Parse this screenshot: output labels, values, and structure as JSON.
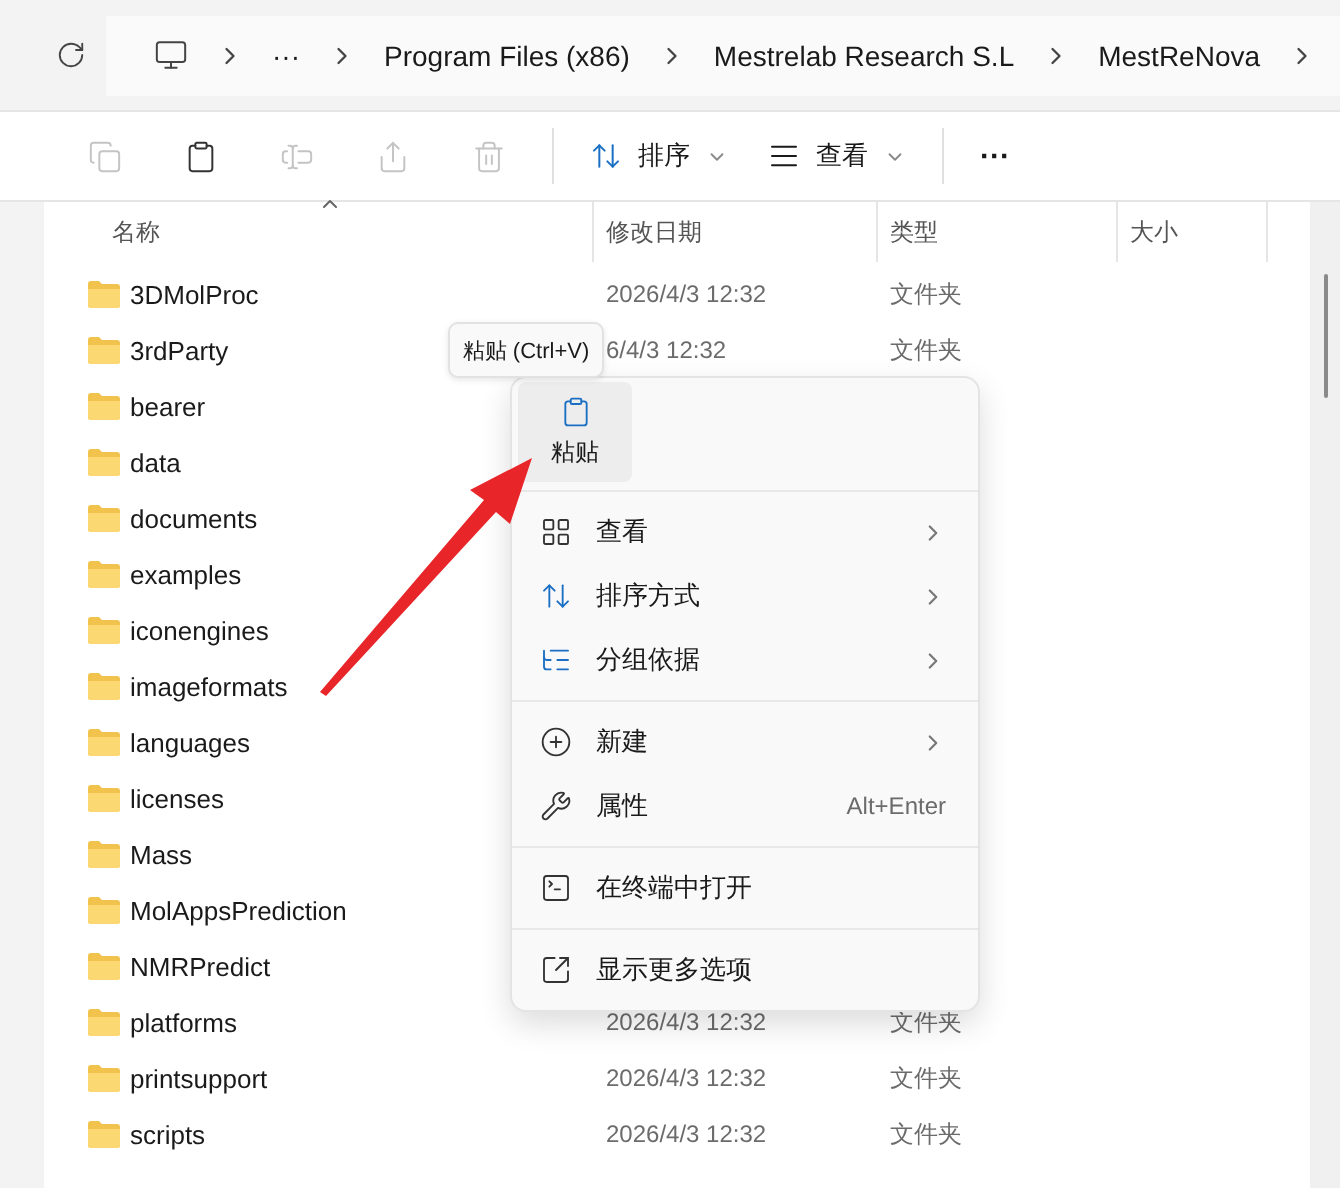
{
  "address_bar": {
    "breadcrumbs": [
      "···",
      "Program Files (x86)",
      "Mestrelab Research S.L",
      "MestReNova"
    ]
  },
  "toolbar": {
    "icon_buttons": [
      {
        "disabled": true
      },
      {
        "disabled": false
      },
      {
        "disabled": true
      },
      {
        "disabled": true
      },
      {
        "disabled": true
      }
    ],
    "sort_button": "排序",
    "view_button": "查看",
    "more_button": "···"
  },
  "table": {
    "columns": [
      {
        "label": "名称",
        "sorted": true
      },
      {
        "label": "修改日期",
        "sorted": false
      },
      {
        "label": "类型",
        "sorted": false
      },
      {
        "label": "大小",
        "sorted": false
      }
    ],
    "rows": [
      {
        "name": "3DMolProc",
        "modified": "2026/4/3 12:32",
        "type": "文件夹"
      },
      {
        "name": "3rdParty",
        "modified": "6/4/3 12:32",
        "type": "文件夹"
      },
      {
        "name": "bearer"
      },
      {
        "name": "data"
      },
      {
        "name": "documents"
      },
      {
        "name": "examples"
      },
      {
        "name": "iconengines"
      },
      {
        "name": "imageformats"
      },
      {
        "name": "languages"
      },
      {
        "name": "licenses"
      },
      {
        "name": "Mass"
      },
      {
        "name": "MolAppsPrediction"
      },
      {
        "name": "NMRPredict"
      },
      {
        "name": "platforms",
        "modified": "2026/4/3 12:32",
        "type": "文件夹"
      },
      {
        "name": "printsupport",
        "modified": "2026/4/3 12:32",
        "type": "文件夹"
      },
      {
        "name": "scripts",
        "modified": "2026/4/3 12:32",
        "type": "文件夹"
      }
    ]
  },
  "tooltip": "粘贴 (Ctrl+V)",
  "context_menu": {
    "top_actions": [
      {
        "label": "粘贴"
      }
    ],
    "groups": [
      [
        {
          "label": "查看",
          "kind": "submenu"
        },
        {
          "label": "排序方式",
          "kind": "submenu"
        },
        {
          "label": "分组依据",
          "kind": "submenu"
        }
      ],
      [
        {
          "label": "新建",
          "kind": "submenu"
        },
        {
          "label": "属性",
          "kind": "shortcut",
          "shortcut": "Alt+Enter"
        }
      ],
      [
        {
          "label": "在终端中打开",
          "kind": "plain"
        }
      ],
      [
        {
          "label": "显示更多选项",
          "kind": "plain"
        }
      ]
    ]
  }
}
